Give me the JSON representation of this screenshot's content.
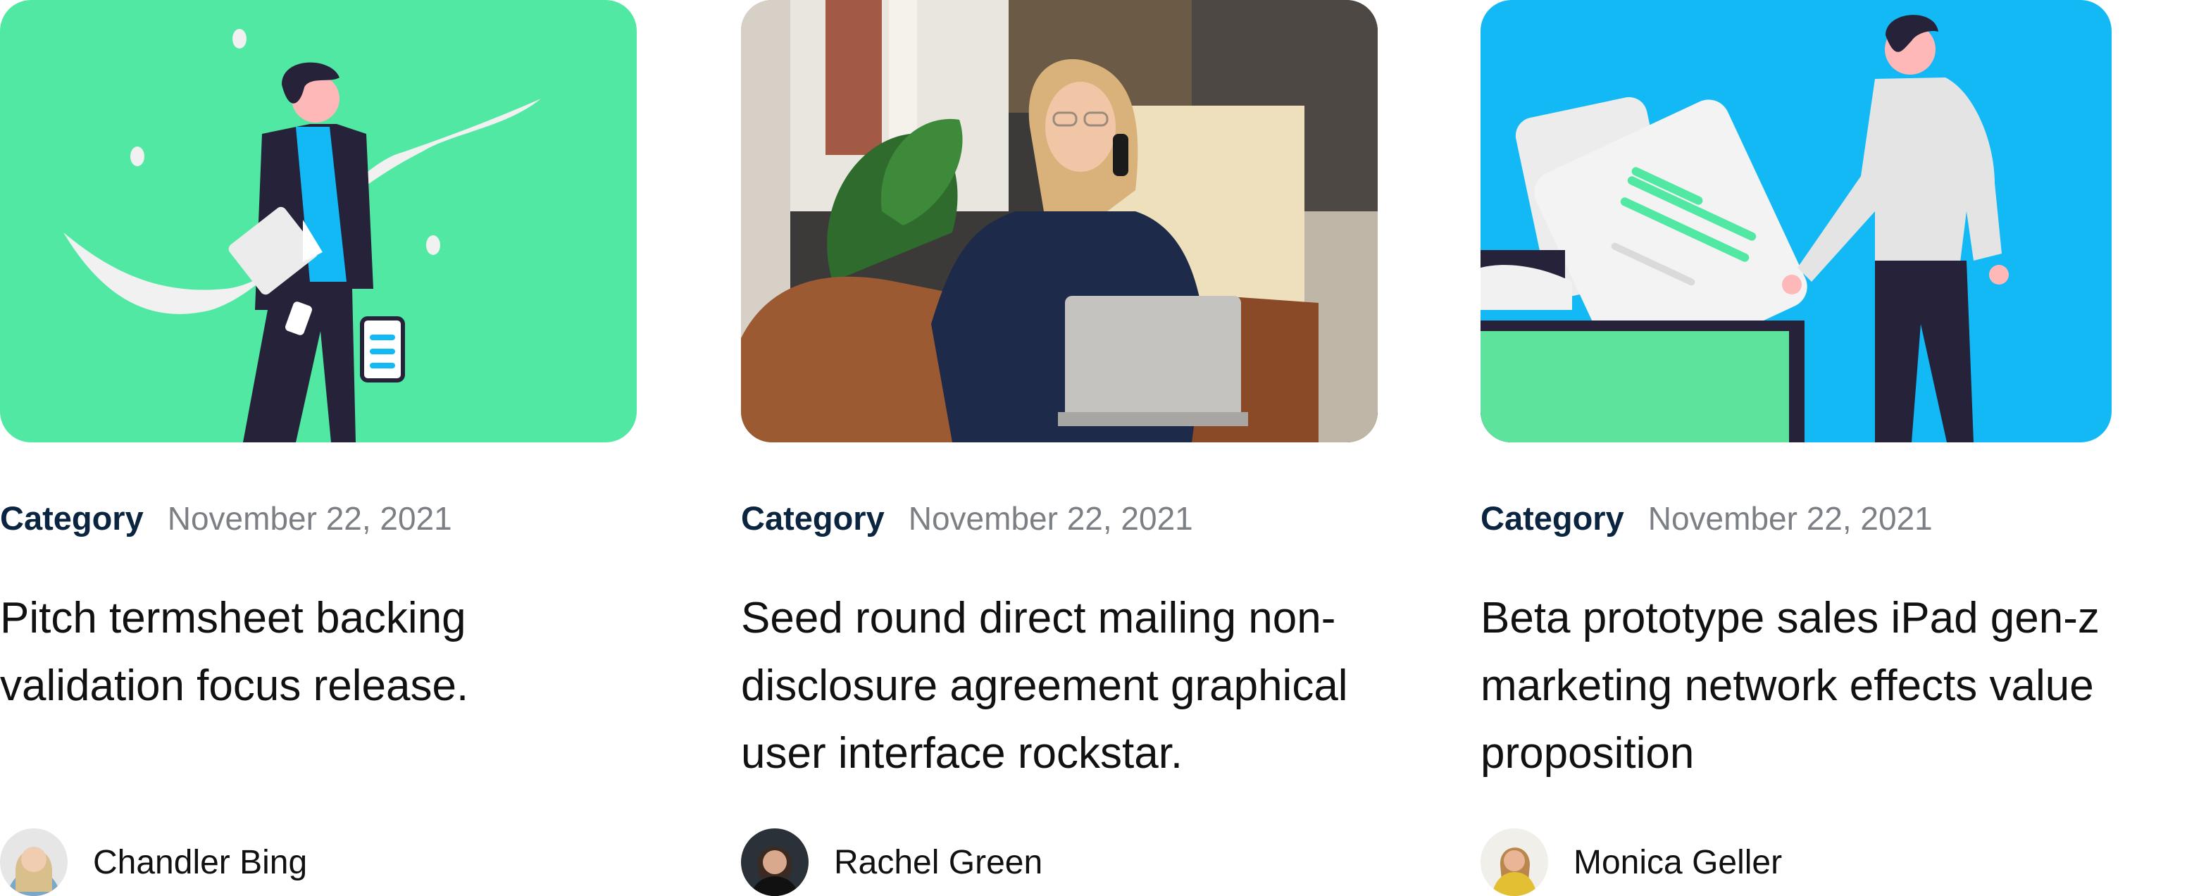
{
  "cards": [
    {
      "image": "illustration-man-with-documents",
      "category": "Category",
      "date": "November 22, 2021",
      "title": "Pitch termsheet backing validation focus release.",
      "author": {
        "name": "Chandler Bing"
      },
      "accent": "#51e8a3"
    },
    {
      "image": "photo-woman-on-phone-with-laptop",
      "category": "Category",
      "date": "November 22, 2021",
      "title": "Seed round direct mailing non-disclosure agreement graphical user interface rockstar.",
      "author": {
        "name": "Rachel Green"
      },
      "accent": "#c79a5f"
    },
    {
      "image": "illustration-man-with-folder",
      "category": "Category",
      "date": "November 22, 2021",
      "title": "Beta prototype sales iPad gen-z marketing network effects value proposition",
      "author": {
        "name": "Monica Geller"
      },
      "accent": "#12b9f5"
    }
  ],
  "colors": {
    "category": "#0b2540",
    "date": "#7c7f84",
    "text": "#111111"
  }
}
